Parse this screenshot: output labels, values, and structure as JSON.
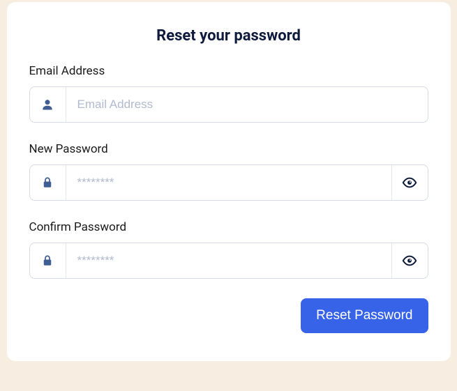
{
  "title": "Reset your password",
  "fields": {
    "email": {
      "label": "Email Address",
      "placeholder": "Email Address",
      "value": ""
    },
    "new_password": {
      "label": "New Password",
      "placeholder": "********",
      "value": ""
    },
    "confirm_password": {
      "label": "Confirm Password",
      "placeholder": "********",
      "value": ""
    }
  },
  "actions": {
    "submit_label": "Reset Password"
  },
  "icons": {
    "user": "user-icon",
    "lock": "lock-icon",
    "eye": "eye-icon"
  },
  "colors": {
    "accent": "#3763e9",
    "icon": "#3f5e94",
    "border": "#d7dbe6",
    "placeholder": "#b1bad0"
  }
}
